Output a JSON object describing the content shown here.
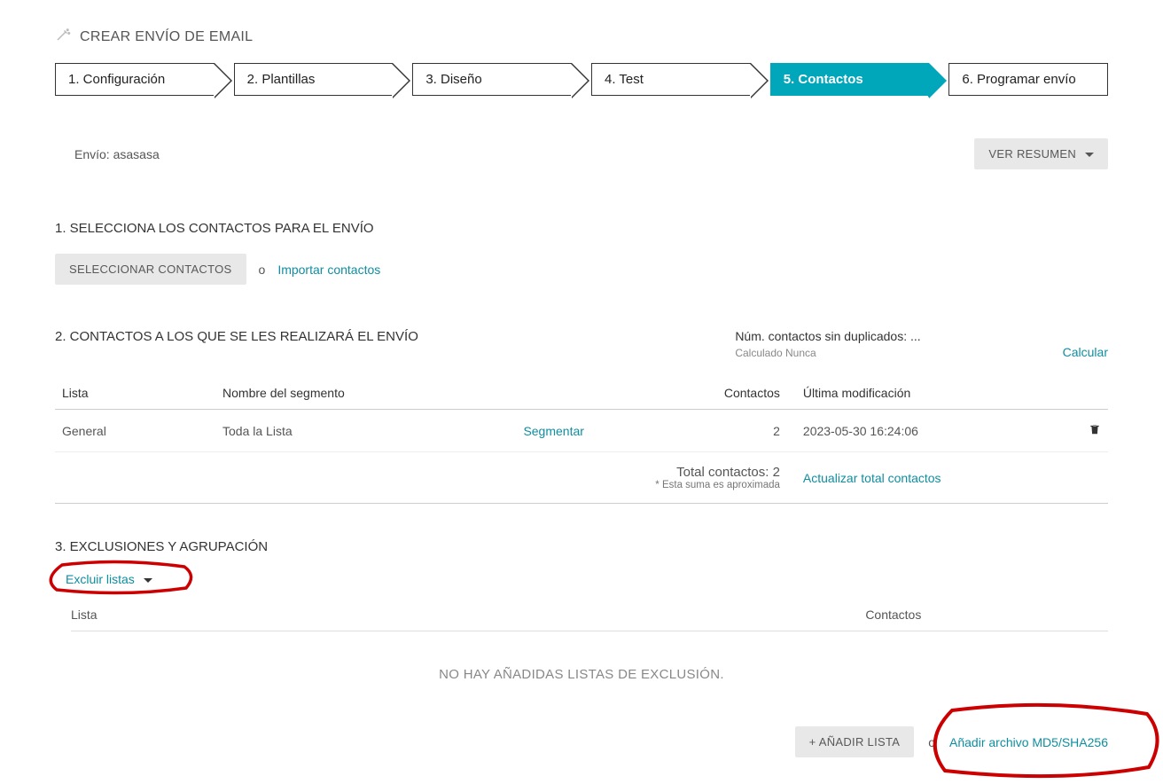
{
  "page": {
    "title": "CREAR ENVÍO DE EMAIL"
  },
  "stepper": {
    "steps": [
      {
        "label": "1. Configuración"
      },
      {
        "label": "2. Plantillas"
      },
      {
        "label": "3. Diseño"
      },
      {
        "label": "4. Test"
      },
      {
        "label": "5. Contactos"
      },
      {
        "label": "6. Programar envío"
      }
    ],
    "active_index": 4
  },
  "envio": {
    "label": "Envío:",
    "value": "asasasa",
    "ver_resumen": "VER RESUMEN"
  },
  "section1": {
    "heading": "1. SELECCIONA LOS CONTACTOS PARA EL ENVÍO",
    "select_btn": "SELECCIONAR CONTACTOS",
    "or": "o",
    "import_link": "Importar contactos"
  },
  "section2": {
    "heading": "2. CONTACTOS A LOS QUE SE LES REALIZARÁ EL ENVÍO",
    "num_line": "Núm. contactos sin duplicados: ...",
    "calc_line": "Calculado Nunca",
    "calcular_link": "Calcular",
    "columns": {
      "lista": "Lista",
      "segmento": "Nombre del segmento",
      "contactos": "Contactos",
      "ultima": "Última modificación"
    },
    "rows": [
      {
        "lista": "General",
        "segmento": "Toda la Lista",
        "segmentar_link": "Segmentar",
        "contactos": "2",
        "ultima": "2023-05-30 16:24:06"
      }
    ],
    "totals": {
      "label": "Total contactos:",
      "value": "2",
      "note": "* Esta suma es aproximada",
      "actualizar_link": "Actualizar total contactos"
    }
  },
  "section3": {
    "heading": "3. EXCLUSIONES Y AGRUPACIÓN",
    "excluir_label": "Excluir listas",
    "columns": {
      "lista": "Lista",
      "contactos": "Contactos"
    },
    "empty": "NO HAY AÑADIDAS LISTAS DE EXCLUSIÓN.",
    "add_lista_btn": "+ AÑADIR LISTA",
    "or": "o",
    "add_archivo_link": "Añadir archivo MD5/SHA256"
  }
}
